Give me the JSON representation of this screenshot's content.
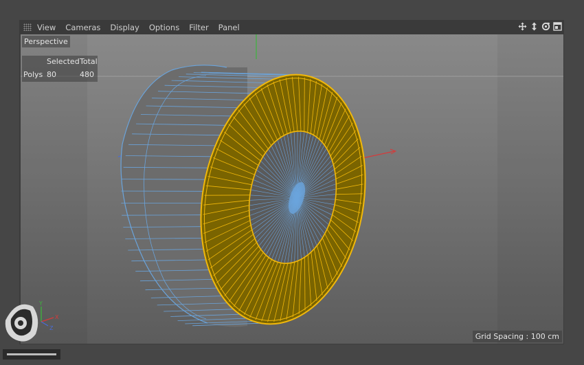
{
  "menu": {
    "items": [
      "View",
      "Cameras",
      "Display",
      "Options",
      "Filter",
      "Panel"
    ]
  },
  "toolbar_icons": [
    "move-view-icon",
    "zoom-view-icon",
    "rotate-view-icon",
    "maximize-panel-icon"
  ],
  "viewport": {
    "camera_label": "Perspective",
    "stats": {
      "selected_header": "Selected",
      "total_header": "Total",
      "row_label": "Polys",
      "selected_value": "80",
      "total_value": "480"
    },
    "grid_spacing": "Grid Spacing : 100 cm"
  },
  "axes": {
    "x": "X",
    "y": "Y",
    "z": "Z"
  },
  "colors": {
    "selection": "#f2b80a",
    "selected_fill": "#7a6400",
    "wire": "#6aa4dc",
    "x_axis": "#d63a3a",
    "y_axis": "#3cb63c",
    "z_axis": "#4a6cd6"
  }
}
